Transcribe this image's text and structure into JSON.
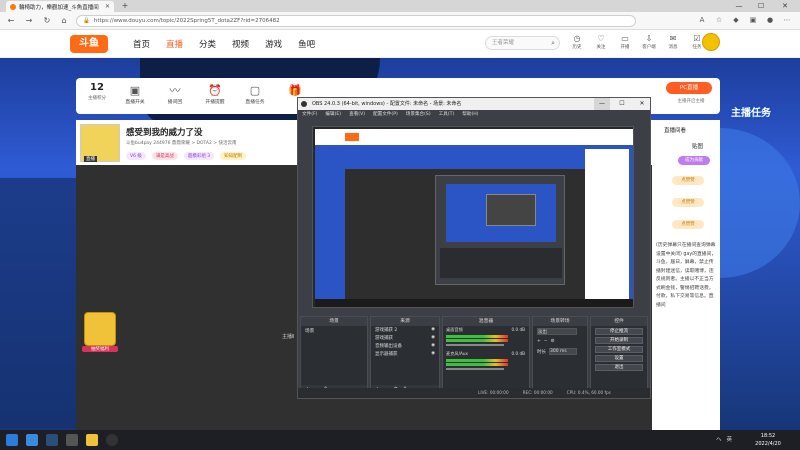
{
  "browser": {
    "tab_title": "輪椅助力，樂觀加速_斗魚直播间",
    "url": "https://www.douyu.com/topic/2022Spring5T_dota2ZF?rid=2706482",
    "new_tab": "+",
    "controls": {
      "minimize": "—",
      "maximize": "☐",
      "close": "✕"
    }
  },
  "douyu": {
    "logo": "斗鱼",
    "nav": [
      "首页",
      "直播",
      "分类",
      "视频",
      "游戏",
      "鱼吧"
    ],
    "search_placeholder": "王者荣耀",
    "user_items": [
      "历史",
      "关注",
      "开播",
      "客户端",
      "消息",
      "任务"
    ]
  },
  "feature_bar": {
    "count": "12",
    "count_label": "主播积分",
    "items": [
      "直播开关",
      "播间回",
      "开播提醒",
      "直播任务",
      "",
      "",
      "",
      "",
      "",
      "",
      "",
      "",
      ""
    ],
    "pc_button": "PC直播",
    "pc_sub": "主播开启主播"
  },
  "stream": {
    "title": "感受到我的威力了没",
    "meta": "斗鱼bu4pay  244976  鼎鼎荣耀 > DOTA2 > 快活云南",
    "anchor_tag": "直播",
    "tags": [
      "V6 级",
      "满是高战",
      "超模彩组 3",
      "知知配制"
    ],
    "gift_label": "抽奖福利",
    "host_label": "主播Ⅱ"
  },
  "chat": {
    "title": "直播间看",
    "tab": "贴图",
    "btn1": "成为贡献",
    "btn2": "点赞赞",
    "btn3": "点赞赞",
    "btn4": "点赞赞",
    "text": "(历史弹幕只在播间查询弹幕设置中关闭) gay的直播间，斗鱼，届日，屏幕，禁止传播封建迷信，读取赌博，违反规则者。主播以不正当方式刷金钱，警惕招聘话费，付款，私下交易等信息。直播间"
  },
  "task_badge": "主播任务",
  "obs": {
    "title": "OBS 24.0.3 (64-bit, windows) - 配置文件: 未命名 - 场景: 未命名",
    "menu": [
      "文件(F)",
      "编辑(E)",
      "查看(V)",
      "配置文件(P)",
      "场景集合(S)",
      "工具(T)",
      "帮助(H)"
    ],
    "docks": {
      "scenes_title": "场景",
      "scenes": [
        "场景"
      ],
      "sources_title": "来源",
      "sources": [
        "游戏捕获 2",
        "游戏捕获",
        "音频输出设备",
        "显示器捕获"
      ],
      "mixer_title": "混音器",
      "mixer": [
        {
          "name": "桌面音频",
          "db": "0.0 dB"
        },
        {
          "name": "麦克风/Aux",
          "db": "0.0 dB"
        }
      ],
      "transitions_title": "场景转场",
      "transition": "淡出",
      "duration_label": "时长",
      "duration": "300 ms",
      "controls_title": "控件",
      "controls": [
        "停止推流",
        "开始录制",
        "工作室模式",
        "设置",
        "退出"
      ]
    },
    "status": [
      "LIVE: 00:00:00",
      "REC: 00:00:00",
      "CPU: 0.4%, 60.00 fps"
    ]
  },
  "taskbar": {
    "tray": [
      "ヘ",
      "英"
    ],
    "time": "18:52",
    "date": "2022/4/20"
  }
}
